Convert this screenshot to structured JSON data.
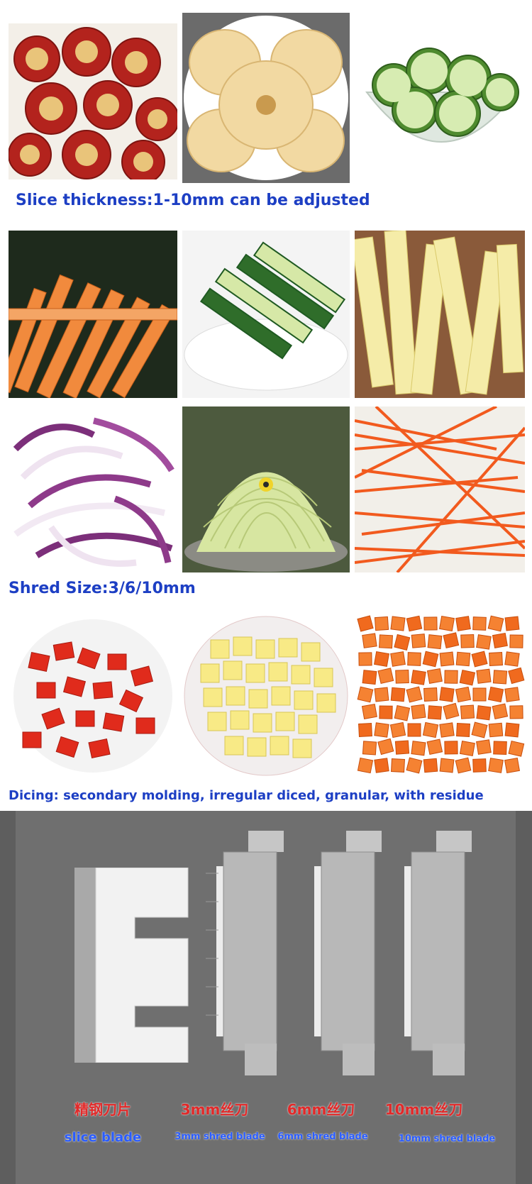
{
  "captions": {
    "slice": "Slice thickness:1-10mm can be adjusted",
    "shred": "Shred Size:3/6/10mm",
    "dice": "Dicing: secondary molding, irregular diced, granular, with residue"
  },
  "blades": [
    {
      "cn": "精钢刀片",
      "en": "slice blade"
    },
    {
      "cn": "3mm丝刀",
      "en": "3mm shred blade"
    },
    {
      "cn": "6mm丝刀",
      "en": "6mm shred blade"
    },
    {
      "cn": "10mm丝刀",
      "en": "10mm shred blade"
    }
  ]
}
